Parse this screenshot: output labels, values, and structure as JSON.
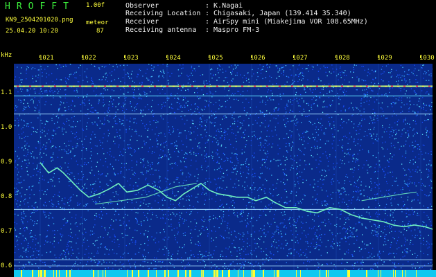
{
  "header": {
    "app_title": "HROFFT",
    "version": "1.00f",
    "filename": "KN9_2504201020.png",
    "mode_label": "meteor",
    "datetime": "25.04.20 10:20",
    "mode_value": "87",
    "info": [
      {
        "key": "Observer",
        "value": ": K.Nagai"
      },
      {
        "key": "Receiving Location",
        "value": ": Chigasaki, Japan (139.414 35.340)"
      },
      {
        "key": "Receiver",
        "value": ": AirSpy mini (Miakejima VOR 108.65MHz)"
      },
      {
        "key": "Receiving antenna",
        "value": ": Maspro FM-3"
      }
    ]
  },
  "chart_data": {
    "type": "heatmap",
    "xlabel": "",
    "ylabel": "kHz",
    "x_ticks": [
      "1021",
      "1022",
      "1023",
      "1024",
      "1025",
      "1026",
      "1027",
      "1028",
      "1029",
      "1030"
    ],
    "y_ticks": [
      "1.1",
      "1.0",
      "0.9",
      "0.8",
      "0.7",
      "0.6"
    ],
    "ylim": [
      0.59,
      1.185
    ],
    "horizontal_lines_khz": [
      1.12,
      1.092,
      1.04,
      0.765,
      0.62,
      0.602
    ],
    "trace_khz": [
      [
        0,
        0.9
      ],
      [
        0.2,
        0.87
      ],
      [
        0.4,
        0.885
      ],
      [
        0.55,
        0.87
      ],
      [
        0.75,
        0.845
      ],
      [
        0.95,
        0.82
      ],
      [
        1.15,
        0.8
      ],
      [
        1.4,
        0.81
      ],
      [
        1.65,
        0.825
      ],
      [
        1.85,
        0.84
      ],
      [
        2.05,
        0.815
      ],
      [
        2.3,
        0.82
      ],
      [
        2.55,
        0.835
      ],
      [
        2.8,
        0.82
      ],
      [
        3.0,
        0.8
      ],
      [
        3.2,
        0.79
      ],
      [
        3.4,
        0.81
      ],
      [
        3.6,
        0.825
      ],
      [
        3.8,
        0.84
      ],
      [
        4.0,
        0.82
      ],
      [
        4.2,
        0.81
      ],
      [
        4.45,
        0.805
      ],
      [
        4.65,
        0.8
      ],
      [
        4.9,
        0.8
      ],
      [
        5.1,
        0.79
      ],
      [
        5.35,
        0.8
      ],
      [
        5.55,
        0.785
      ],
      [
        5.8,
        0.77
      ],
      [
        6.05,
        0.77
      ],
      [
        6.3,
        0.76
      ],
      [
        6.55,
        0.755
      ],
      [
        6.85,
        0.77
      ],
      [
        7.1,
        0.765
      ],
      [
        7.35,
        0.75
      ],
      [
        7.6,
        0.74
      ],
      [
        7.85,
        0.735
      ],
      [
        8.1,
        0.73
      ],
      [
        8.35,
        0.72
      ],
      [
        8.6,
        0.715
      ],
      [
        8.85,
        0.72
      ],
      [
        9.1,
        0.715
      ],
      [
        9.35,
        0.705
      ],
      [
        9.55,
        0.7
      ],
      [
        9.85,
        0.7
      ]
    ],
    "trace2_khz": [
      [
        1.3,
        0.78
      ],
      [
        1.9,
        0.79
      ],
      [
        2.5,
        0.8
      ],
      [
        3.2,
        0.83
      ],
      [
        3.7,
        0.84
      ]
    ],
    "trace3_khz": [
      [
        7.6,
        0.79
      ],
      [
        8.1,
        0.8
      ],
      [
        8.6,
        0.81
      ],
      [
        8.9,
        0.815
      ]
    ],
    "colors": {
      "background": "#0a2a8a",
      "noise": [
        "#1a50ff",
        "#2e8cff",
        "#3cc0ff",
        "#60e8ff"
      ],
      "trace": "#70f0c0",
      "axis_text": "#ffff3c",
      "bottom_bar": "#10c8f0"
    }
  }
}
